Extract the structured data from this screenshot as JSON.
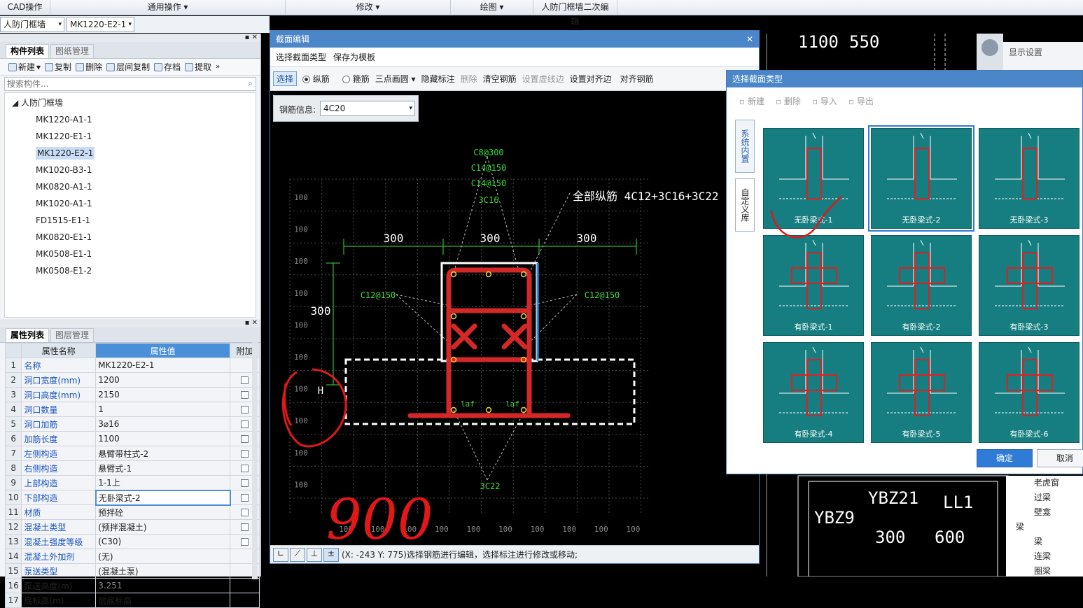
{
  "menu": {
    "cad": "CAD操作",
    "general": "通用操作",
    "modify": "修改",
    "draw": "绘图",
    "edit2": "人防门框墙二次编辑"
  },
  "combos": {
    "type": "人防门框墙",
    "item": "MK1220-E2-1"
  },
  "comp": {
    "tab1": "构件列表",
    "tab2": "图纸管理",
    "tb": [
      "新建",
      "复制",
      "删除",
      "层间复制",
      "存档",
      "提取"
    ],
    "search_placeholder": "搜索构件...",
    "root": "人防门框墙",
    "items": [
      "MK1220-A1-1",
      "MK1220-E1-1",
      "MK1220-E2-1",
      "MK1020-B3-1",
      "MK0820-A1-1",
      "MK1020-A1-1",
      "FD1515-E1-1",
      "MK0820-E1-1",
      "MK0508-E1-1",
      "MK0508-E1-2"
    ],
    "selected": 2
  },
  "props": {
    "tab1": "属性列表",
    "tab2": "图层管理",
    "h_name": "属性名称",
    "h_val": "属性值",
    "h_add": "附加",
    "rows": [
      {
        "n": "1",
        "k": "名称",
        "v": "MK1220-E2-1",
        "cb": false
      },
      {
        "n": "2",
        "k": "洞口宽度(mm)",
        "v": "1200",
        "cb": true
      },
      {
        "n": "3",
        "k": "洞口高度(mm)",
        "v": "2150",
        "cb": true
      },
      {
        "n": "4",
        "k": "洞口数量",
        "v": "1",
        "cb": true
      },
      {
        "n": "5",
        "k": "洞口加筋",
        "v": "3⌀16",
        "cb": true
      },
      {
        "n": "6",
        "k": "加筋长度",
        "v": "1100",
        "cb": true
      },
      {
        "n": "7",
        "k": "左侧构造",
        "v": "悬臂带柱式-2",
        "cb": true
      },
      {
        "n": "8",
        "k": "右侧构造",
        "v": "悬臂式-1",
        "cb": true
      },
      {
        "n": "9",
        "k": "上部构造",
        "v": "1-1上",
        "cb": true
      },
      {
        "n": "10",
        "k": "下部构造",
        "v": "无卧梁式-2",
        "cb": true
      },
      {
        "n": "11",
        "k": "材质",
        "v": "预拌砼",
        "cb": true
      },
      {
        "n": "12",
        "k": "混凝土类型",
        "v": "(预拌混凝土)",
        "cb": true
      },
      {
        "n": "13",
        "k": "混凝土强度等级",
        "v": "(C30)",
        "cb": true
      },
      {
        "n": "14",
        "k": "混凝土外加剂",
        "v": "(无)",
        "cb": false
      },
      {
        "n": "15",
        "k": "泵送类型",
        "v": "(混凝土泵)",
        "cb": false
      },
      {
        "n": "16",
        "k": "泵送高度(m)",
        "v": "3.251",
        "cb": false
      },
      {
        "n": "17",
        "k": "底标高(m)",
        "v": "层底标高",
        "cb": false
      }
    ]
  },
  "section": {
    "title": "截面编辑",
    "m1": "选择截面类型",
    "m2": "保存为模板",
    "tb": {
      "select": "选择",
      "long": "纵筋",
      "stir": "箍筋",
      "arc": "三点画圆",
      "hide": "隐藏标注",
      "del": "删除",
      "clear": "清空钢筋",
      "virt": "设置虚线边",
      "align": "设置对齐边",
      "alignbar": "对齐钢筋"
    },
    "rebar_label": "钢筋信息:",
    "rebar_value": "4C20",
    "ann": {
      "c8": "C8@300",
      "c14a": "C14@150",
      "c14b": "C14@150",
      "c16": "3C16",
      "all": "全部纵筋 4C12+3C16+3C22",
      "d1": "300",
      "d2": "300",
      "d3": "300",
      "dv": "300",
      "c12l": "C12@150",
      "c12r": "C12@150",
      "h": "H",
      "laf1": "laf",
      "laf2": "laf",
      "c22": "3C22",
      "grid": "100"
    },
    "status": "(X: -243 Y: 775)选择钢筋进行编辑，选择标注进行修改或移动;"
  },
  "picker": {
    "title": "选择截面类型",
    "tb": [
      "新建",
      "删除",
      "导入",
      "导出"
    ],
    "side1": "系统内置",
    "side2": "自定义库",
    "items": [
      "无卧梁式-1",
      "无卧梁式-2",
      "无卧梁式-3",
      "有卧梁式-1",
      "有卧梁式-2",
      "有卧梁式-3",
      "有卧梁式-4",
      "有卧梁式-5",
      "有卧梁式-6"
    ],
    "selected": 1,
    "ok": "确定",
    "cancel": "取消"
  },
  "right": {
    "display": "显示设置",
    "tree": [
      "老虎窗",
      "过梁",
      "壁龛",
      "梁",
      "梁",
      "连梁",
      "圈梁"
    ],
    "cad_top": [
      "1100",
      "550"
    ],
    "cad_bottom": [
      "YBZ21",
      "LL1",
      "YBZ9",
      "300",
      "600"
    ]
  },
  "annot_hand": "900"
}
